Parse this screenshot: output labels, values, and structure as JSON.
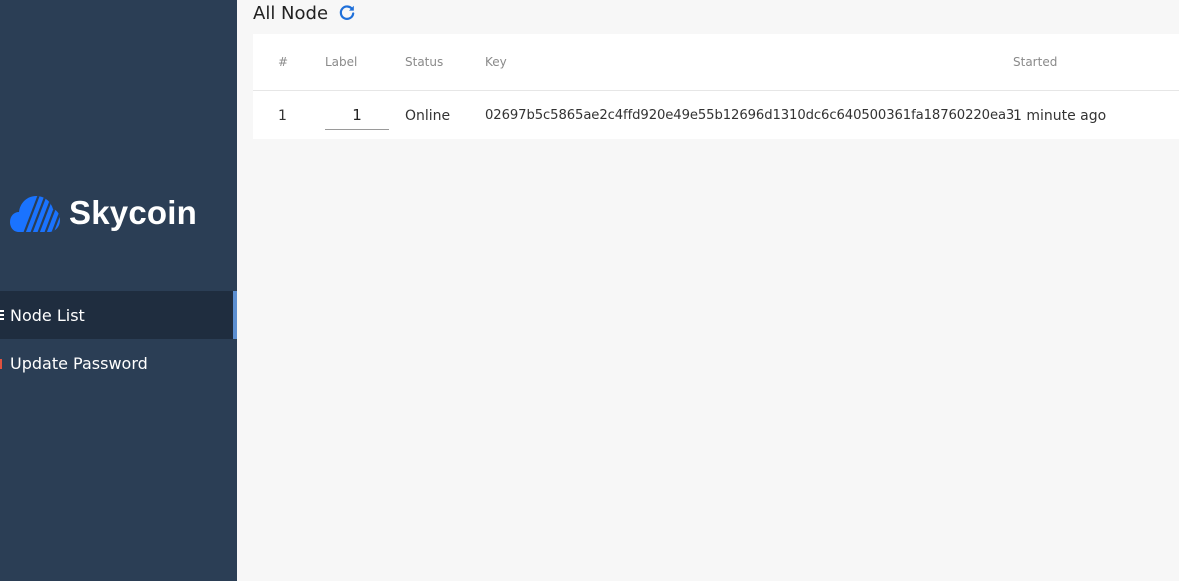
{
  "sidebar": {
    "brand_name": "Skycoin",
    "brand_color": "#0072ff",
    "items": [
      {
        "label": "Node List",
        "icon": "list-icon",
        "active": true
      },
      {
        "label": "Update Password",
        "icon": "lock-icon",
        "active": false
      }
    ]
  },
  "header": {
    "title": "All Node",
    "refresh_icon": "refresh-icon",
    "accent_color": "#1e6fd9"
  },
  "table": {
    "columns": [
      "#",
      "Label",
      "Status",
      "Key",
      "Started"
    ],
    "rows": [
      {
        "num": "1",
        "label": "1",
        "status": "Online",
        "key": "02697b5c5865ae2c4ffd920e49e55b12696d1310dc6c640500361fa18760220ea3",
        "started": "1 minute ago"
      }
    ]
  }
}
